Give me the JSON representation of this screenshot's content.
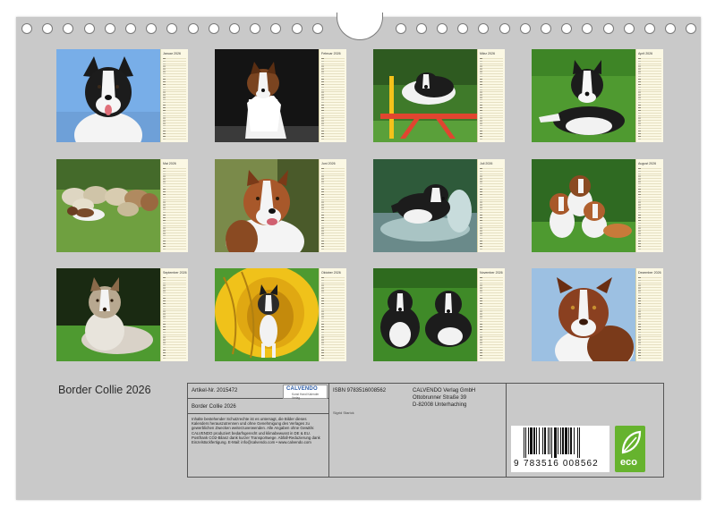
{
  "calendar": {
    "title": "Border Collie 2026",
    "months": [
      {
        "label": "Januar 2026",
        "subject": "dog-portrait-sky"
      },
      {
        "label": "Februar 2026",
        "subject": "dog-sitting-dark"
      },
      {
        "label": "März 2026",
        "subject": "dog-agility-jump"
      },
      {
        "label": "April 2026",
        "subject": "dog-lying-grass"
      },
      {
        "label": "Mai 2026",
        "subject": "dog-herding-sheep"
      },
      {
        "label": "Juni 2026",
        "subject": "dog-portrait-tricolor"
      },
      {
        "label": "Juli 2026",
        "subject": "dog-running-water"
      },
      {
        "label": "August 2026",
        "subject": "dogs-group-garden"
      },
      {
        "label": "September 2026",
        "subject": "dog-merle-lying"
      },
      {
        "label": "Oktober 2026",
        "subject": "dog-agility-tunnel"
      },
      {
        "label": "November 2026",
        "subject": "two-dogs-lying"
      },
      {
        "label": "Dezember 2026",
        "subject": "dog-portrait-red"
      }
    ]
  },
  "info": {
    "article": "Artikel-Nr. 2015472",
    "product_title": "Border Collie 2026",
    "legal_text": "Inhalte bestehender Schutzrechte ist es untersagt, die Bilder dieses Kalenders herauszutrennen und ohne Genehmigung des Verlages zu gewerblichen Zwecken weiterzuverwenden. Alle Angaben ohne Gewähr. CALVENDO produziert bedarfsgerecht und klimabewusst in DE & EU. Postfrank CO2-Bilanz dank kurzer Transportwege. Abfall-Reduzierung dank Einzelstückfertigung. E-Mail: info@calvendo.com • www.calvendo.com",
    "isbn": "ISBN 9783516008562",
    "author": "Sigrid Starick",
    "publisher": [
      "CALVENDO Verlag GmbH",
      "Ottobrunner Straße 39",
      "D-82008 Unterhaching"
    ],
    "logo_main": "CALVENDO",
    "logo_sub": "Kunst Hand Kalender Verlag",
    "barcode_lead": "9",
    "barcode_digits": "783516 008562",
    "eco_label": "eco"
  },
  "colors": {
    "sheet": "#c9c9c9",
    "calendar_strip": "#fbf8e4",
    "eco_green": "#66b32e",
    "logo_blue": "#2a5aa5"
  }
}
